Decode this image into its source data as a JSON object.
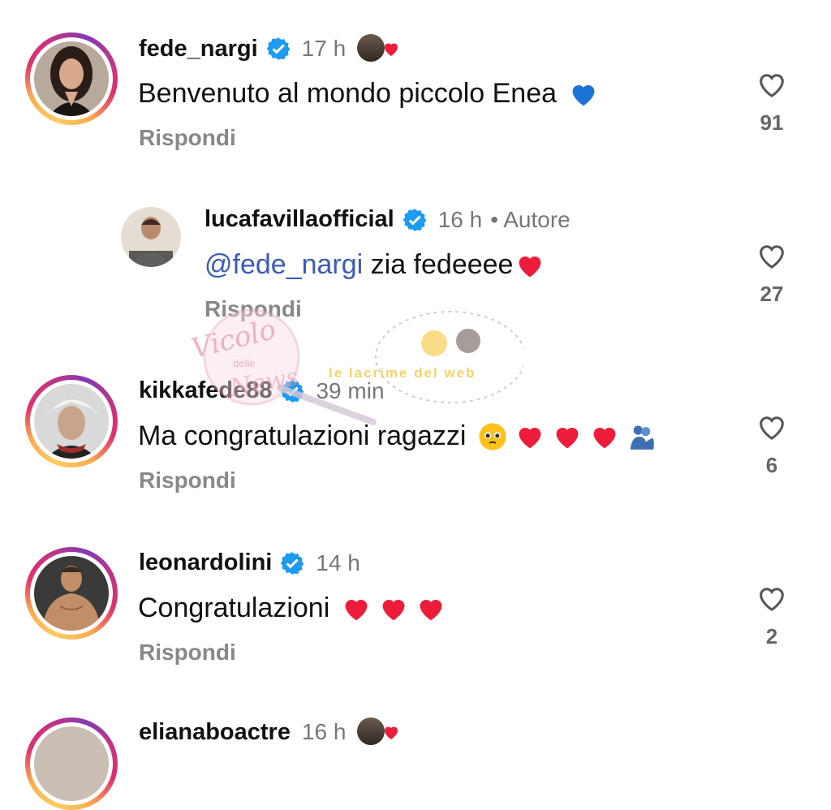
{
  "comments": [
    {
      "username": "fede_nargi",
      "time": "17 h",
      "text": "Benvenuto al mondo piccolo  Enea",
      "emoji": "blue-heart",
      "reply_label": "Rispondi",
      "likes": "91",
      "liked_by_author": true
    },
    {
      "username": "lucafavillaofficial",
      "time": "16 h",
      "author_label": "• Autore",
      "mention": "@fede_nargi",
      "text": " zia fedeeee",
      "emoji": "red-heart",
      "reply_label": "Rispondi",
      "likes": "27"
    },
    {
      "username": "kikkafede88",
      "time": "39 min",
      "text": "Ma congratulazioni ragazzi",
      "emojis": [
        "pleading-face",
        "red-heart",
        "red-heart",
        "red-heart",
        "people-hugging"
      ],
      "reply_label": "Rispondi",
      "likes": "6"
    },
    {
      "username": "leonardolini",
      "time": "14 h",
      "text": "Congratulazioni",
      "emojis": [
        "red-heart",
        "red-heart",
        "red-heart"
      ],
      "reply_label": "Rispondi",
      "likes": "2"
    },
    {
      "username": "elianaboactre",
      "time": "16 h",
      "liked_by_author": true
    }
  ],
  "watermark": {
    "text1": "Vicolo",
    "text2": "delle",
    "text3": "News",
    "text4": "le lacrime del web"
  },
  "colors": {
    "verified": "#1d9bf0",
    "mention": "#3b5bb5",
    "muted": "#777777",
    "heart": "#e0245e"
  }
}
